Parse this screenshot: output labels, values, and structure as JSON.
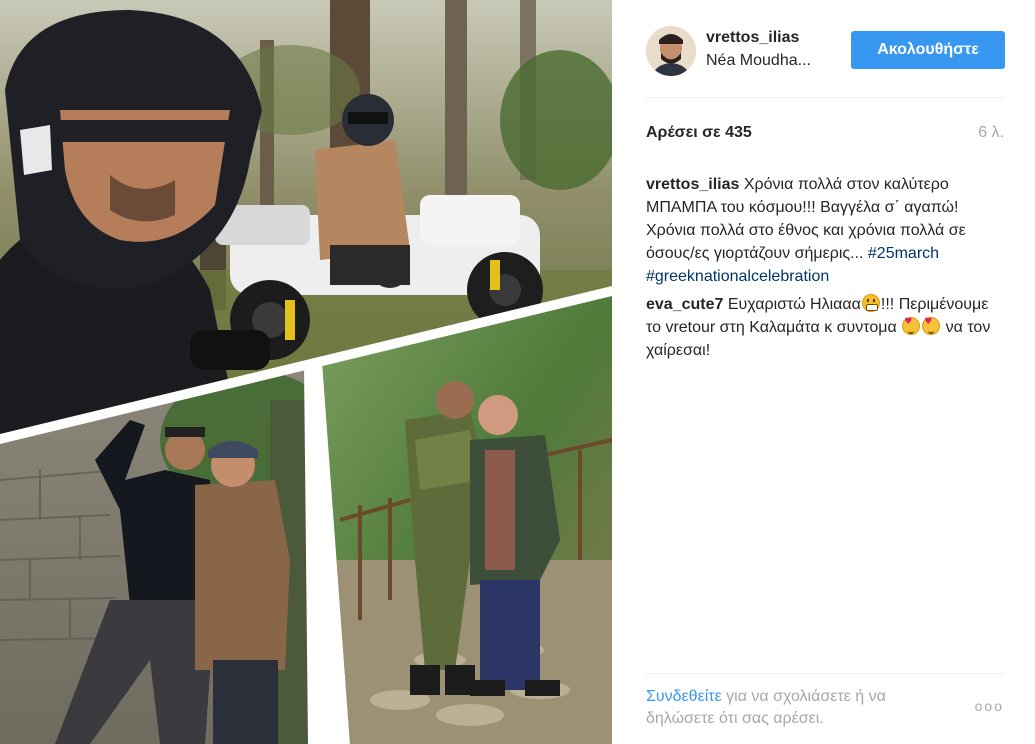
{
  "post": {
    "username": "vrettos_ilias",
    "location": "Néa Moudha...",
    "follow_label": "Ακολουθήστε",
    "likes": "Αρέσει σε 435",
    "time": "6 λ."
  },
  "caption": {
    "username": "vrettos_ilias",
    "text": " Χρόνια πολλά στον καλύτερο ΜΠΑΜΠΑ του κόσμου!!! Βαγγέλα σ΄ αγαπώ! Χρόνια πολλά στο έθνος και χρόνια πολλά σε όσους/ες γιορτάζουν σήμερις... ",
    "hashtag1": "#25march",
    "hashtag2": "#greeknationalcelebration"
  },
  "comment": {
    "username": "eva_cute7",
    "text_part1": " Ευχαριστώ Ηλιααα",
    "text_part2": "!!! Περιμένουμε το vretour στη Καλαμάτα κ συντομα ",
    "text_part3": " να τον χαίρεσαι!"
  },
  "footer": {
    "login_label": "Συνδεθείτε",
    "rest_text": " για να σχολιάσετε ή να δηλώσετε ότι σας αρέσει.",
    "more_label": "ooo"
  },
  "icons": {
    "more": "ellipsis-icon",
    "emoji_grin": "grin-emoji-icon",
    "emoji_heart_eyes": "heart-eyes-emoji-icon"
  },
  "colors": {
    "follow_button": "#3897f0",
    "hashtag": "#003569",
    "muted": "#a5a7aa",
    "divider": "#efefef"
  }
}
